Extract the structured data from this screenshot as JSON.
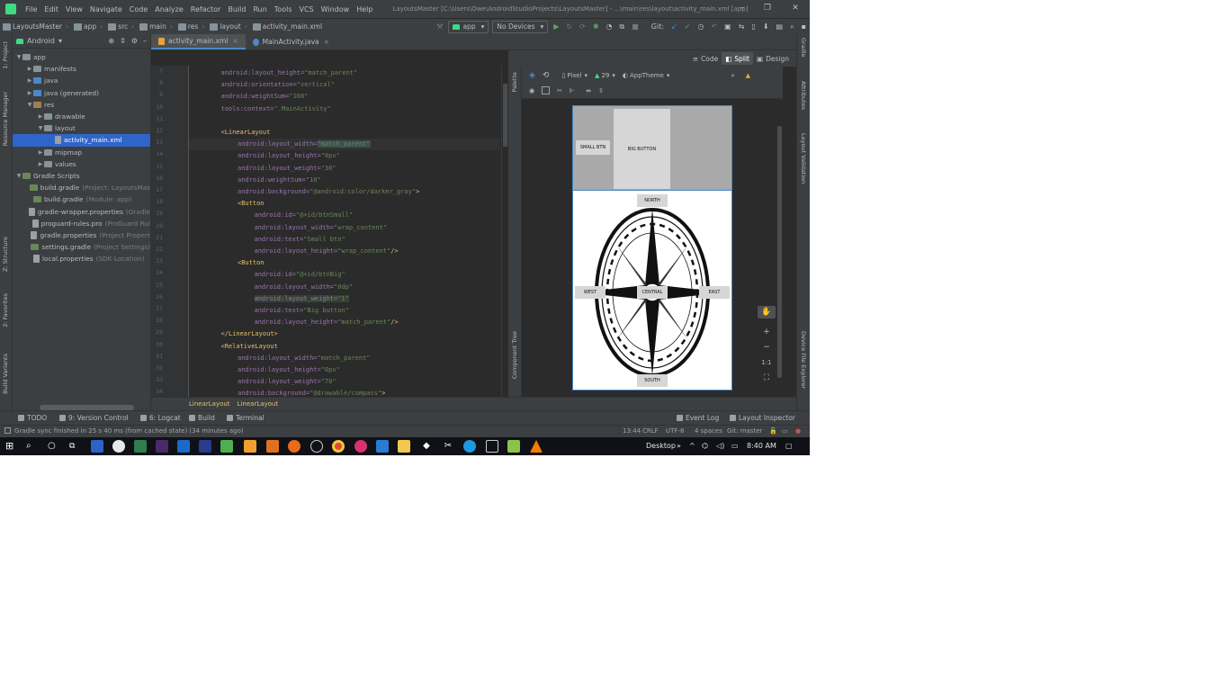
{
  "menubar": {
    "items": [
      "File",
      "Edit",
      "View",
      "Navigate",
      "Code",
      "Analyze",
      "Refactor",
      "Build",
      "Run",
      "Tools",
      "VCS",
      "Window",
      "Help"
    ],
    "title": "LayoutsMaster [C:\\Users\\Owe\\AndroidStudioProjects\\LayoutsMaster] - ...\\main\\res\\layout\\activity_main.xml [app]"
  },
  "navbar": {
    "breadcrumbs": [
      "LayoutsMaster",
      "app",
      "src",
      "main",
      "res",
      "layout",
      "activity_main.xml"
    ],
    "run_config": "app",
    "device": "No Devices",
    "git_label": "Git:"
  },
  "project_panel": {
    "view_selector": "Android",
    "tree": [
      {
        "label": "app",
        "muted": "",
        "indent": 0,
        "arrow": "▼",
        "kind": "folder"
      },
      {
        "label": "manifests",
        "muted": "",
        "indent": 1,
        "arrow": "▶",
        "kind": "folder"
      },
      {
        "label": "java",
        "muted": "",
        "indent": 1,
        "arrow": "▶",
        "kind": "src"
      },
      {
        "label": "java (generated)",
        "muted": "",
        "indent": 1,
        "arrow": "▶",
        "kind": "src"
      },
      {
        "label": "res",
        "muted": "",
        "indent": 1,
        "arrow": "▼",
        "kind": "res"
      },
      {
        "label": "drawable",
        "muted": "",
        "indent": 2,
        "arrow": "▶",
        "kind": "folder"
      },
      {
        "label": "layout",
        "muted": "",
        "indent": 2,
        "arrow": "▼",
        "kind": "folder"
      },
      {
        "label": "activity_main.xml",
        "muted": "",
        "indent": 3,
        "arrow": "",
        "kind": "file"
      },
      {
        "label": "mipmap",
        "muted": "",
        "indent": 2,
        "arrow": "▶",
        "kind": "folder"
      },
      {
        "label": "values",
        "muted": "",
        "indent": 2,
        "arrow": "▶",
        "kind": "folder"
      },
      {
        "label": "Gradle Scripts",
        "muted": "",
        "indent": 0,
        "arrow": "▼",
        "kind": "grd"
      },
      {
        "label": "build.gradle",
        "muted": "(Project: LayoutsMas",
        "indent": 1,
        "arrow": "",
        "kind": "grd"
      },
      {
        "label": "build.gradle",
        "muted": "(Module: app)",
        "indent": 1,
        "arrow": "",
        "kind": "grd"
      },
      {
        "label": "gradle-wrapper.properties",
        "muted": "(Gradle",
        "indent": 1,
        "arrow": "",
        "kind": "file"
      },
      {
        "label": "proguard-rules.pro",
        "muted": "(ProGuard Rul",
        "indent": 1,
        "arrow": "",
        "kind": "file"
      },
      {
        "label": "gradle.properties",
        "muted": "(Project Propert",
        "indent": 1,
        "arrow": "",
        "kind": "file"
      },
      {
        "label": "settings.gradle",
        "muted": "(Project Settings)",
        "indent": 1,
        "arrow": "",
        "kind": "grd"
      },
      {
        "label": "local.properties",
        "muted": "(SDK Location)",
        "indent": 1,
        "arrow": "",
        "kind": "file"
      }
    ],
    "selected_index": 7
  },
  "left_stripe": [
    "1: Project",
    "Resource Manager",
    "Z: Structure",
    "2: Favorites",
    "Build Variants"
  ],
  "editor": {
    "tabs": [
      {
        "label": "activity_main.xml",
        "active": true,
        "kind": "xml"
      },
      {
        "label": "MainActivity.java",
        "active": false,
        "kind": "java"
      }
    ],
    "view_modes": [
      "Code",
      "Split",
      "Design"
    ],
    "active_view_mode": "Split",
    "breadcrumb": [
      "LinearLayout",
      "LinearLayout"
    ]
  },
  "code_lines": [
    {
      "n": "7",
      "indent": 1,
      "parts": [
        [
          "attr",
          "android:layout_height="
        ],
        [
          "val",
          "\"match_parent\""
        ]
      ]
    },
    {
      "n": "8",
      "indent": 1,
      "parts": [
        [
          "attr",
          "android:orientation="
        ],
        [
          "val",
          "\"vertical\""
        ]
      ]
    },
    {
      "n": "9",
      "indent": 1,
      "parts": [
        [
          "attr",
          "android:weightSum="
        ],
        [
          "val",
          "\"100\""
        ]
      ]
    },
    {
      "n": "10",
      "indent": 1,
      "parts": [
        [
          "attr",
          "tools:context="
        ],
        [
          "val",
          "\".MainActivity\""
        ]
      ]
    },
    {
      "n": "11",
      "indent": 0,
      "parts": []
    },
    {
      "n": "12",
      "indent": 1,
      "parts": [
        [
          "tag",
          "<LinearLayout"
        ]
      ]
    },
    {
      "n": "13",
      "indent": 2,
      "parts": [
        [
          "attr",
          "android:layout_width="
        ],
        [
          "val",
          "\"match_parent\""
        ]
      ],
      "current": true
    },
    {
      "n": "14",
      "indent": 2,
      "parts": [
        [
          "attr",
          "android:layout_height="
        ],
        [
          "val",
          "\"0px\""
        ]
      ]
    },
    {
      "n": "15",
      "indent": 2,
      "parts": [
        [
          "attr",
          "android:layout_weight="
        ],
        [
          "val",
          "\"30\""
        ]
      ]
    },
    {
      "n": "16",
      "indent": 2,
      "parts": [
        [
          "attr",
          "android:weightSum="
        ],
        [
          "val",
          "\"10\""
        ]
      ]
    },
    {
      "n": "17",
      "indent": 2,
      "parts": [
        [
          "attr",
          "android:background="
        ],
        [
          "val",
          "\"@android:color/darker_gray\""
        ],
        [
          "tag",
          ">"
        ]
      ]
    },
    {
      "n": "18",
      "indent": 2,
      "parts": [
        [
          "tag",
          "<Button"
        ]
      ]
    },
    {
      "n": "19",
      "indent": 3,
      "parts": [
        [
          "attr",
          "android:id="
        ],
        [
          "val",
          "\"@+id/btnSmall\""
        ]
      ]
    },
    {
      "n": "20",
      "indent": 3,
      "parts": [
        [
          "attr",
          "android:layout_width="
        ],
        [
          "val",
          "\"wrap_content\""
        ]
      ]
    },
    {
      "n": "21",
      "indent": 3,
      "parts": [
        [
          "attr",
          "android:text="
        ],
        [
          "val",
          "\"Small btn\""
        ]
      ]
    },
    {
      "n": "22",
      "indent": 3,
      "parts": [
        [
          "attr",
          "android:layout_height="
        ],
        [
          "val",
          "\"wrap_content\""
        ],
        [
          "tag",
          "/>"
        ]
      ]
    },
    {
      "n": "23",
      "indent": 2,
      "parts": [
        [
          "tag",
          "<Button"
        ]
      ]
    },
    {
      "n": "24",
      "indent": 3,
      "parts": [
        [
          "attr",
          "android:id="
        ],
        [
          "val",
          "\"@+id/btnBig\""
        ]
      ]
    },
    {
      "n": "25",
      "indent": 3,
      "parts": [
        [
          "attr",
          "android:layout_width="
        ],
        [
          "val",
          "\"0dp\""
        ]
      ]
    },
    {
      "n": "26",
      "indent": 3,
      "parts": [
        [
          "attr",
          "android:layout_weight="
        ],
        [
          "val",
          "\"1\""
        ]
      ],
      "highlight": true
    },
    {
      "n": "27",
      "indent": 3,
      "parts": [
        [
          "attr",
          "android:text="
        ],
        [
          "val",
          "\"Big button\""
        ]
      ]
    },
    {
      "n": "28",
      "indent": 3,
      "parts": [
        [
          "attr",
          "android:layout_height="
        ],
        [
          "val",
          "\"match_parent\""
        ],
        [
          "tag",
          "/>"
        ]
      ]
    },
    {
      "n": "29",
      "indent": 1,
      "parts": [
        [
          "tag",
          "</LinearLayout>"
        ]
      ]
    },
    {
      "n": "30",
      "indent": 1,
      "parts": [
        [
          "tag",
          "<RelativeLayout"
        ]
      ]
    },
    {
      "n": "31",
      "indent": 2,
      "parts": [
        [
          "attr",
          "android:layout_width="
        ],
        [
          "val",
          "\"match_parent\""
        ]
      ]
    },
    {
      "n": "32",
      "indent": 2,
      "parts": [
        [
          "attr",
          "android:layout_height="
        ],
        [
          "val",
          "\"0px\""
        ]
      ]
    },
    {
      "n": "33",
      "indent": 2,
      "parts": [
        [
          "attr",
          "android:layout_weight="
        ],
        [
          "val",
          "\"70\""
        ]
      ]
    },
    {
      "n": "34",
      "indent": 2,
      "parts": [
        [
          "attr",
          "android:background="
        ],
        [
          "val",
          "\"@drawable/compass\""
        ],
        [
          "tag",
          ">"
        ]
      ]
    }
  ],
  "design": {
    "palette_label": "Palette",
    "component_tree_label": "Component Tree",
    "device": "Pixel",
    "api": "29",
    "theme": "AppTheme",
    "preview_buttons": {
      "small": "SMALL BTN",
      "big": "BIG BUTTON",
      "north": "NORTH",
      "west": "WEST",
      "central": "CENTRAL",
      "east": "EAST",
      "south": "SOUTH"
    },
    "zoom_ratio": "1:1"
  },
  "right_stripe": [
    "Gradle",
    "Attributes",
    "Layout Validation",
    "Device File Explorer"
  ],
  "bottom_tabs": [
    "TODO",
    "9: Version Control",
    "6: Logcat",
    "Build",
    "Terminal",
    "Event Log",
    "Layout Inspector"
  ],
  "status": {
    "message": "Gradle sync finished in 25 s 40 ms (from cached state) (34 minutes ago)",
    "position": "13:44",
    "line_sep": "CRLF",
    "encoding": "UTF-8",
    "indent": "4 spaces",
    "branch": "Git: master"
  },
  "taskbar": {
    "desktop": "Desktop",
    "time": "8:40 AM"
  },
  "colors": {
    "ide_bg": "#2b2b2b",
    "panel_bg": "#3c3f41",
    "selection": "#2f65ca",
    "xml_tag": "#e8bf6a",
    "xml_attr": "#9876aa",
    "xml_value": "#6a8759",
    "android_green": "#3ddc84"
  }
}
